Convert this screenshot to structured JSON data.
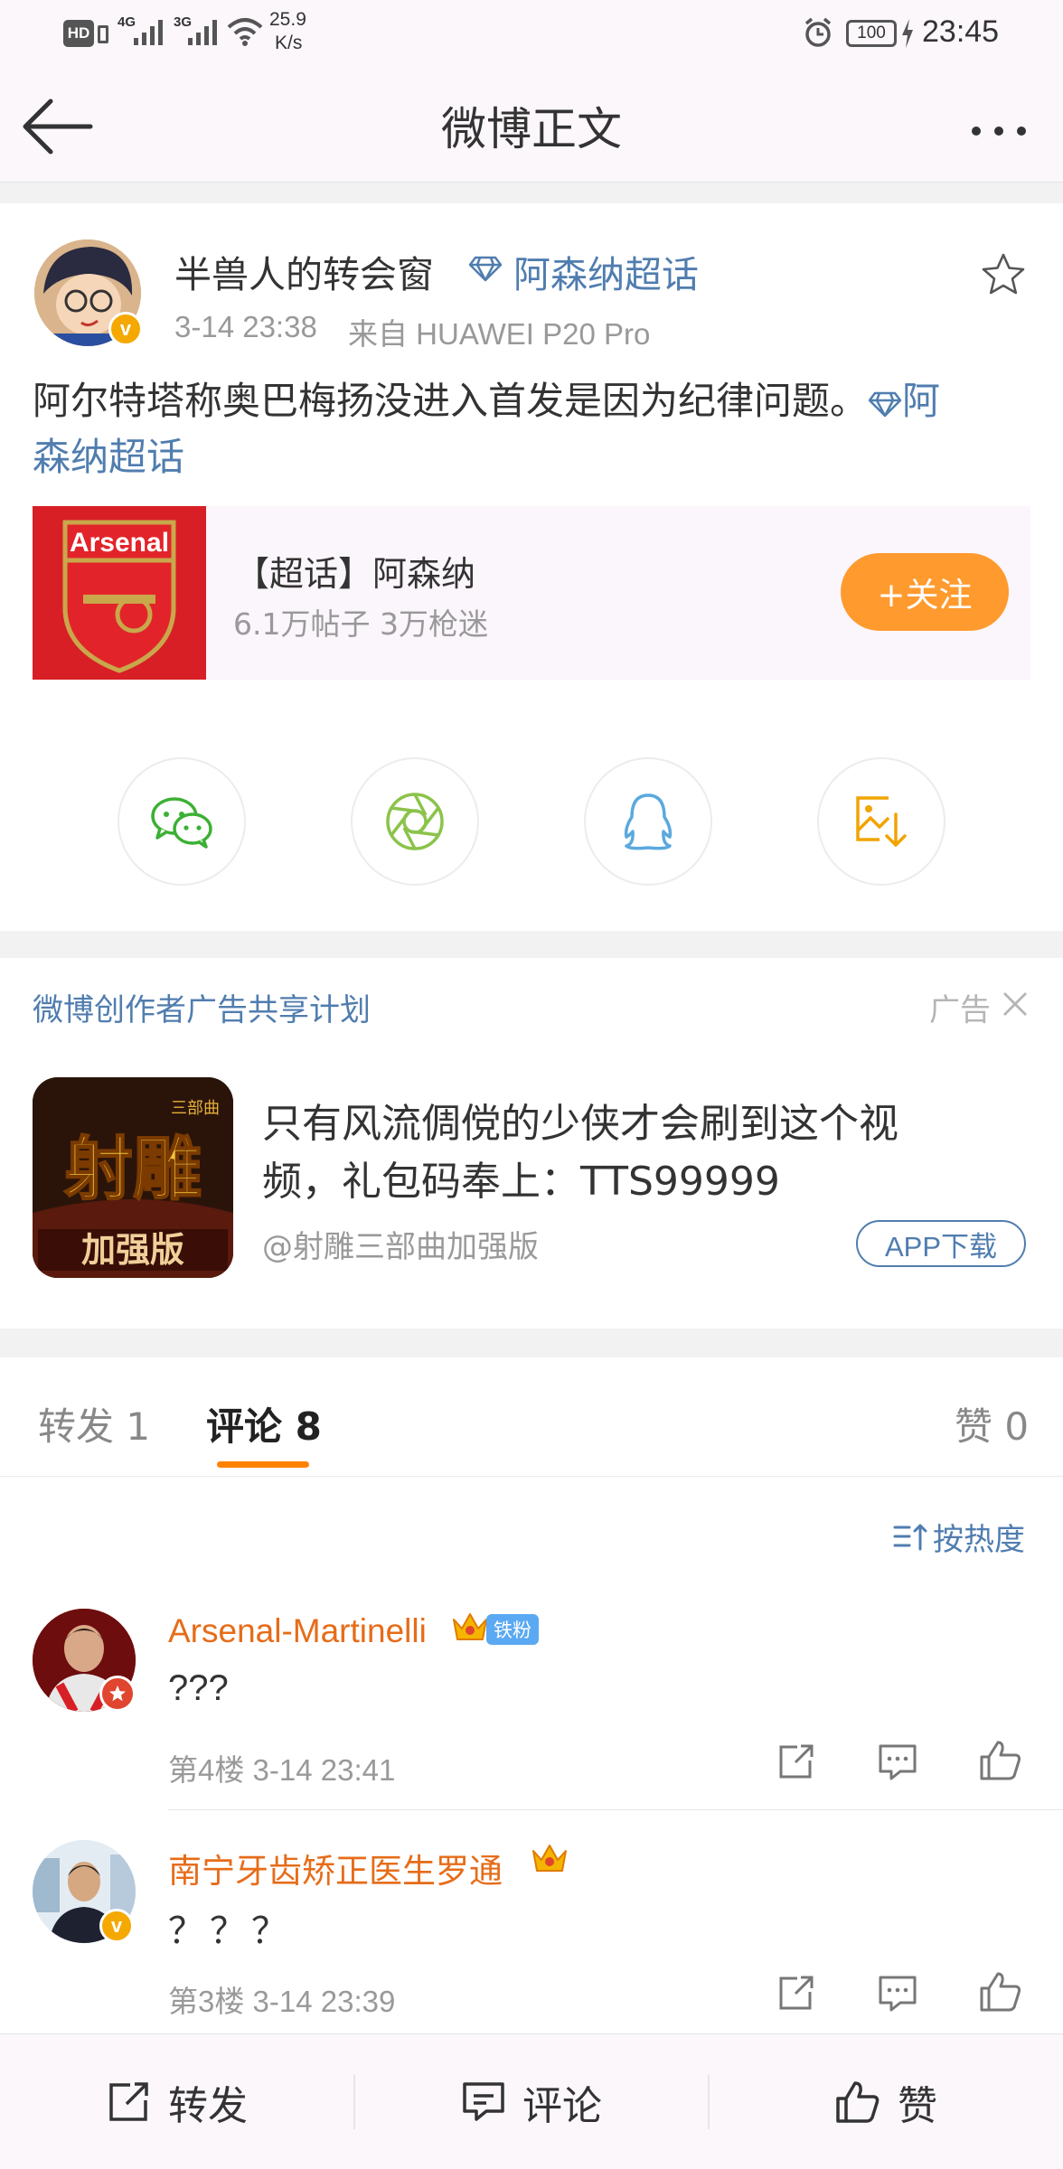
{
  "status_bar": {
    "hd": "HD",
    "net1": "4G",
    "net2": "3G",
    "speed_value": "25.9",
    "speed_unit": "K/s",
    "battery": "100",
    "time": "23:45"
  },
  "nav": {
    "title": "微博正文"
  },
  "post": {
    "username": "半兽人的转会窗",
    "topic_tag": "阿森纳超话",
    "time": "3-14 23:38",
    "source": "来自 HUAWEI P20 Pro",
    "text": "阿尔特塔称奥巴梅扬没进入首发是因为纪律问题。",
    "inline_topic_line1": "阿",
    "inline_topic_line2": "森纳超话"
  },
  "topic_card": {
    "logo_text": "Arsenal",
    "title": "【超话】阿森纳",
    "stats": "6.1万帖子 3万枪迷",
    "follow_label": "+关注"
  },
  "ad": {
    "plan_label": "微博创作者广告共享计划",
    "ad_label": "广告",
    "title_line1": "只有风流倜傥的少侠才会刷到这个视",
    "title_line2": "频，礼包码奉上：TTS99999",
    "source": "@射雕三部曲加强版",
    "download_label": "APP下载",
    "icon_main": "射雕",
    "icon_sub": "加强版",
    "icon_small": "三部曲"
  },
  "tabs": {
    "repost": "转发 1",
    "comment": "评论 8",
    "like": "赞 0"
  },
  "sort_label": "按热度",
  "comments": [
    {
      "name": "Arsenal-Martinelli",
      "badge": "铁粉",
      "text": "???",
      "meta": "第4楼 3-14 23:41"
    },
    {
      "name": "南宁牙齿矫正医生罗通",
      "text": "？？？",
      "meta": "第3楼 3-14 23:39"
    }
  ],
  "bottom_bar": {
    "repost": "转发",
    "comment": "评论",
    "like": "赞"
  },
  "colors": {
    "link_blue": "#507daf",
    "accent_orange": "#ff8200",
    "follow_orange": "#ff9a2e",
    "commenter_orange": "#e66c19"
  }
}
